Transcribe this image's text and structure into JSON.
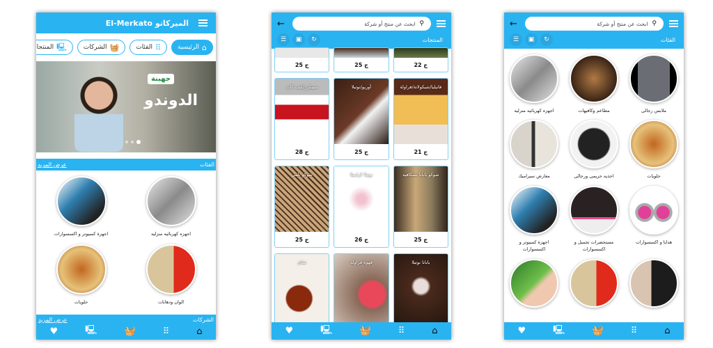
{
  "colors": {
    "accent": "#2ab3f1",
    "card_border": "#7fd0f5"
  },
  "home": {
    "app_title": "El-Merkato الميركاتو",
    "pills": [
      {
        "label": "الرئيسية",
        "icon": "home-icon",
        "active": true
      },
      {
        "label": "الفئات",
        "icon": "grid-icon"
      },
      {
        "label": "الشركات",
        "icon": "basket-icon"
      },
      {
        "label": "المنتجات",
        "icon": "devices-icon"
      }
    ],
    "banner": {
      "brand": "جهينة",
      "title": "الدوندو"
    },
    "categories_header": "الفئات",
    "see_more": "عرض المزيد",
    "categories": [
      {
        "name": "اجهزه كهربائيه منزليه",
        "color": "linear-gradient(135deg,#e8e8e8,#8a8a8a,#e0e0e0)"
      },
      {
        "name": "اجهزة كمبيوتر و اكسسوارات",
        "color": "linear-gradient(135deg,#fff,#2f7fb0 40%,#222 80%)"
      },
      {
        "name": "الوان ودهانات",
        "color": "linear-gradient(90deg,#d9c59b 0 55%,#e02a1c 55%)"
      },
      {
        "name": "حلويات",
        "color": "radial-gradient(circle,#c2661f,#e6c27a 60%,#a54d17)"
      }
    ],
    "companies_header": "الشركات",
    "companies_see_more": "عرض المزيد"
  },
  "bottom_nav": [
    {
      "icon": "heart-icon",
      "glyph": "♥"
    },
    {
      "icon": "devices-icon",
      "glyph": "🖳"
    },
    {
      "icon": "basket-icon",
      "glyph": "🧺"
    },
    {
      "icon": "grid-icon",
      "glyph": "⠿"
    },
    {
      "icon": "home-icon",
      "glyph": "⌂"
    }
  ],
  "products": {
    "search_placeholder": "ابحث عن منتج أو شركة",
    "section_title": "المنتجات",
    "top_partial_prices": [
      "25 ج",
      "25 ج",
      "22 ج"
    ],
    "items": [
      {
        "title": "سنيكرز/كيت كات",
        "price": "28 ج",
        "color": "linear-gradient(#bbb 0 25%,#fff 25% 40%,#c8141e 40% 62%,#fff 62%)"
      },
      {
        "title": "أوريو/نوتيلا",
        "price": "25 ج",
        "color": "linear-gradient(135deg,#3a1f14,#6b3a26 50%,#f2f2f2 60%,#2a1a12)"
      },
      {
        "title": "فانيليا/شيكولاتة/فراولة",
        "price": "21 ج",
        "color": "linear-gradient(#5a2a18 0 25%,#f0be55 25% 70%,#e8e0d8 70%)"
      },
      {
        "title": "شوكو تلمى",
        "price": "25 ج",
        "color": "repeating-linear-gradient(45deg,#c9a57a 0 4px,#4a2e1c 4px 6px)"
      },
      {
        "title": "نوتيلا كراميلا",
        "price": "26 ج",
        "color": "radial-gradient(circle,#f2c2d0 10%,#fff 30%),linear-gradient(#fff,#fff)"
      },
      {
        "title": "شوكو بابانا نسكافيه",
        "price": "25 ج",
        "color": "linear-gradient(90deg,#3a2d22,#c9a878 40%,#8a7a5c 70%,#2f241c)"
      },
      {
        "title": "شاي",
        "price": "",
        "color": "radial-gradient(circle at 45% 55%,#8a2a0c 0 18px,#f4efe9 20px)"
      },
      {
        "title": "قهوة فراولة",
        "price": "",
        "color": "radial-gradient(circle at 70% 50%,#e8485a 0 18px,#8a6a5a 22px,#d8ccc0)"
      },
      {
        "title": "بابانا نوتيلا",
        "price": "",
        "color": "radial-gradient(circle at 50% 40%,#e8ddd8 0 10px,#4a2a1c 14px,#1c120c)"
      }
    ]
  },
  "categories_page": {
    "search_placeholder": "ابحث عن منتج أو شركة",
    "section_title": "الفئات",
    "items": [
      {
        "name": "ملابس رجالى",
        "color": "linear-gradient(90deg,#000 0 15%,#6a6e74 15% 85%,#000 85%)"
      },
      {
        "name": "مطاعم وكافيهات",
        "color": "radial-gradient(circle,#b07a44,#3a2416 70%)"
      },
      {
        "name": "اجهزه كهربائيه منزليه",
        "color": "linear-gradient(135deg,#e8e8e8,#8a8a8a,#e0e0e0)"
      },
      {
        "name": "حلويات",
        "color": "radial-gradient(circle,#c2661f,#e6c27a 60%,#a54d17)"
      },
      {
        "name": "احذيه حريمى ورجالى",
        "color": "radial-gradient(circle,#222 0 22px,#f2f2f2 24px)"
      },
      {
        "name": "معارض سيراميك",
        "color": "linear-gradient(90deg,#d8d4cc 0 45%,#333 45% 52%,#e8e4dc 52%)"
      },
      {
        "name": "هدايا و اكسسوارات",
        "color": "radial-gradient(circle at 30% 55%,#e0409a 0 9px,#aaa 10px 13px,transparent 14px),radial-gradient(circle at 70% 55%,#e0409a 0 9px,#aaa 10px 13px,#fff 14px)"
      },
      {
        "name": "مستحضرات تجميل و اكسسوارات",
        "color": "linear-gradient(#2a2222 0 65%,#e84a8a 65% 70%,#eee 70%)"
      },
      {
        "name": "اجهزة كمبيوتر و اكسسوارات",
        "color": "linear-gradient(135deg,#fff,#2f7fb0 40%,#222 80%)"
      },
      {
        "name": "",
        "color": "linear-gradient(90deg,#d8c4b0 0 45%,#1c1c1c 45%)"
      },
      {
        "name": "",
        "color": "linear-gradient(90deg,#d9c59b 0 55%,#e02a1c 55%)"
      },
      {
        "name": "",
        "color": "linear-gradient(135deg,#2d7a2a,#6fbf4a 50%,#f0c8b0 60%)"
      }
    ]
  }
}
